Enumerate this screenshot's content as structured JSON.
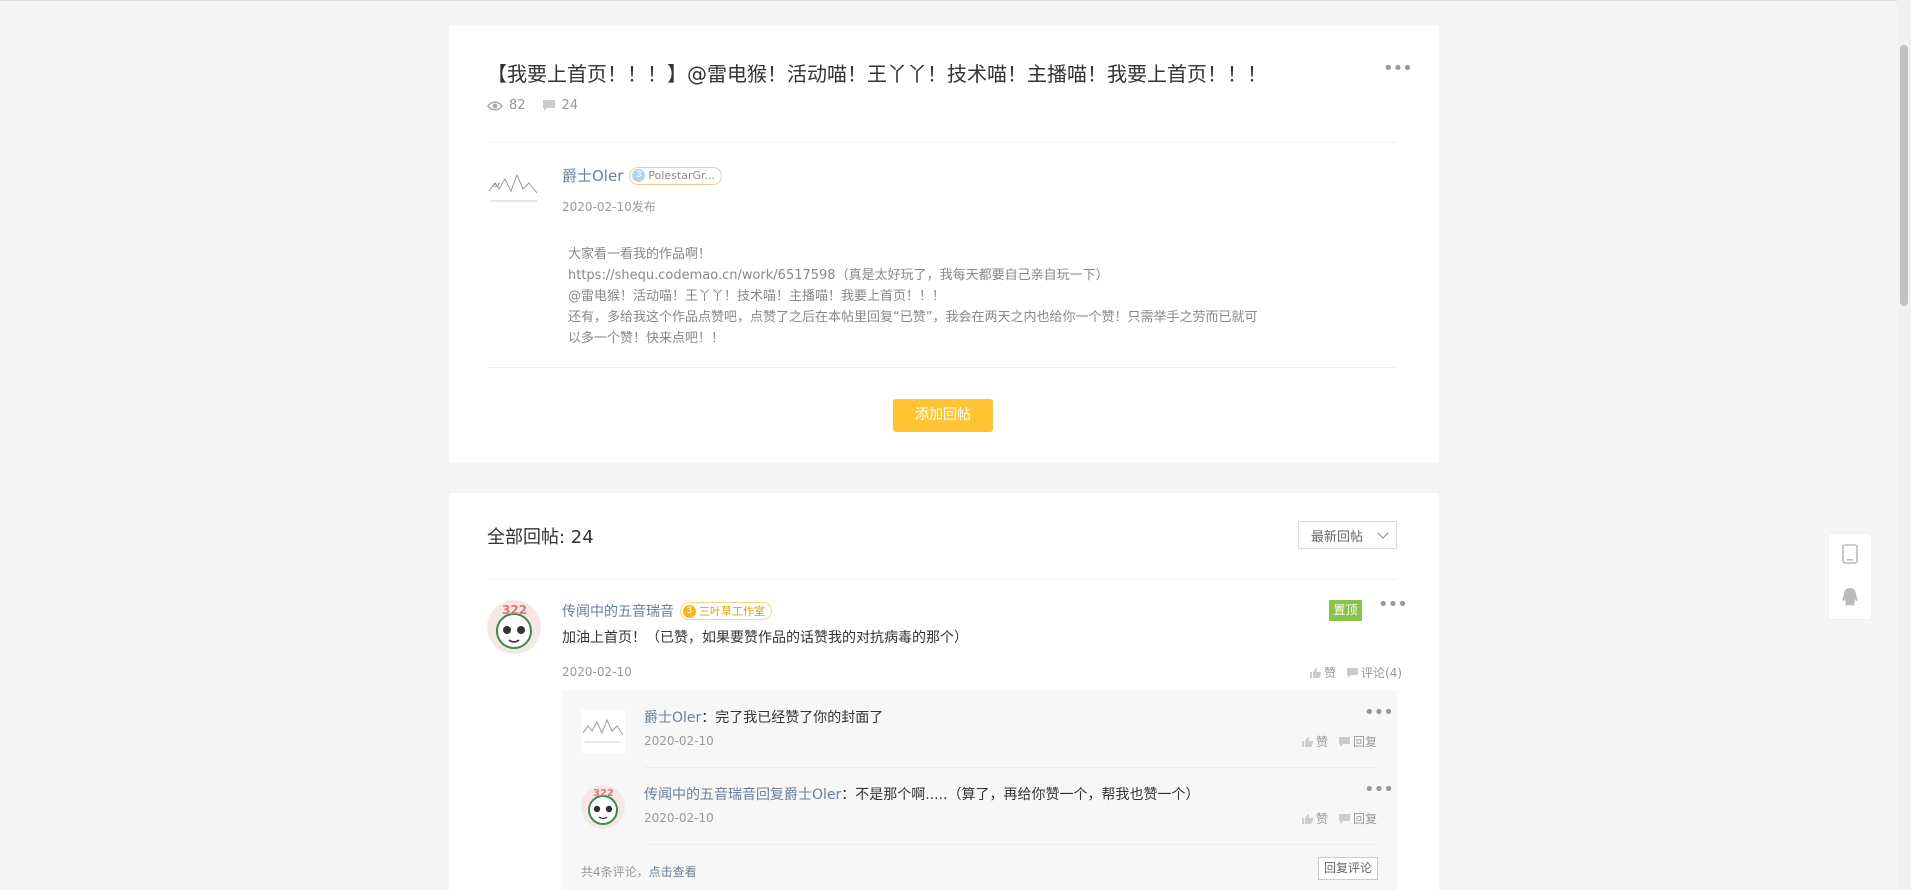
{
  "post": {
    "title": "【我要上首页！！！】@雷电猴！活动喵！王丫丫！技术喵！主播喵！我要上首页！！！",
    "views": "82",
    "comments": "24",
    "author": "爵士Oler",
    "author_level": "3",
    "author_studio": "PolestarGr...",
    "date": "2020-02-10发布",
    "content_lines": [
      "大家看一看我的作品啊！",
      "https://shequ.codemao.cn/work/6517598（真是太好玩了，我每天都要自己亲自玩一下）",
      "@雷电猴！活动喵！王丫丫！技术喵！主播喵！我要上首页！！！",
      "还有，多给我这个作品点赞吧，点赞了之后在本帖里回复“已赞”，我会在两天之内也给你一个赞！只需举手之劳而已就可",
      "以多一个赞！快来点吧！！"
    ],
    "add_reply_label": "添加回帖"
  },
  "replies": {
    "title": "全部回帖: 24",
    "sort_label": "最新回帖",
    "first": {
      "author": "传闻中的五音瑞音",
      "level": "3",
      "studio": "三叶草工作室",
      "pin_label": "置顶",
      "text": "加油上首页！（已赞，如果要赞作品的话赞我的对抗病毒的那个）",
      "date": "2020-02-10",
      "like_label": "赞",
      "comment_label": "评论(4)"
    },
    "sub_comments": [
      {
        "name": "爵士Oler",
        "sep": "：",
        "text": "完了我已经赞了你的封面了",
        "date": "2020-02-10",
        "like_label": "赞",
        "reply_label": "回复"
      },
      {
        "name": "传闻中的五音瑞音",
        "mid": "回复",
        "name2": "爵士Oler",
        "sep": "：",
        "text": "不是那个啊.....（算了，再给你赞一个，帮我也赞一个）",
        "date": "2020-02-10",
        "like_label": "赞",
        "reply_label": "回复"
      }
    ],
    "footer_count": "共4条评论，",
    "footer_link": "点击查看",
    "reply_comment_label": "回复评论"
  },
  "colors": {
    "accent_yellow": "#fec433",
    "pin_green": "#8bc34a",
    "name_blue": "#6a7f99"
  },
  "icons": [
    "eye-icon",
    "comment-icon",
    "more-icon",
    "thumb-up-icon",
    "chevron-down-icon",
    "phone-icon",
    "qq-icon"
  ]
}
